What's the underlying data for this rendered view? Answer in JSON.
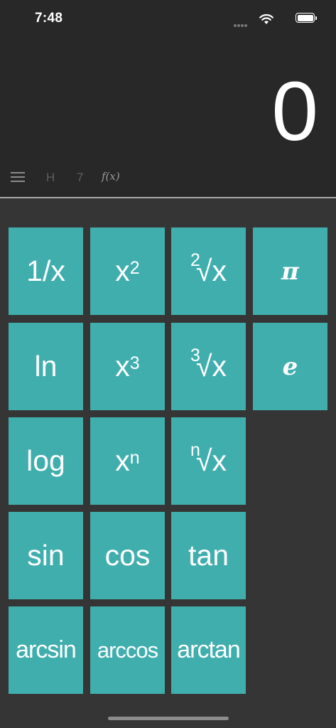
{
  "status": {
    "time": "7:48"
  },
  "display": {
    "value": "0"
  },
  "toolbar": {
    "menu_icon": "hamburger-menu-icon",
    "history_label": "H",
    "seven_label": "7",
    "function_label": "f(x)"
  },
  "keys": {
    "reciprocal": "1/x",
    "square_base": "x",
    "square_exp": "2",
    "sqrt_index": "2",
    "sqrt_body": "√x",
    "pi": "π",
    "ln": "ln",
    "cube_base": "x",
    "cube_exp": "3",
    "cbrt_index": "3",
    "cbrt_body": "√x",
    "e": "e",
    "log": "log",
    "pow_base": "x",
    "pow_exp": "n",
    "nroot_index": "n",
    "nroot_body": "√x",
    "sin": "sin",
    "cos": "cos",
    "tan": "tan",
    "arcsin": "arcsin",
    "arccos": "arccos",
    "arctan": "arctan"
  },
  "colors": {
    "key": "#41aeae",
    "top_background": "#282828",
    "keypad_background": "#353535"
  }
}
